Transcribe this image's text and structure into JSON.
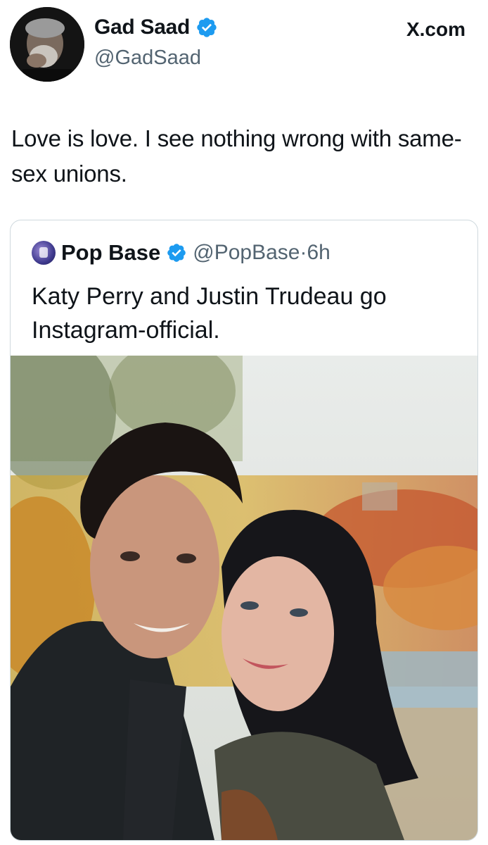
{
  "author": {
    "name": "Gad Saad",
    "handle": "@GadSaad"
  },
  "site_label": "X.com",
  "tweet": {
    "text": "Love is love.  I see nothing wrong with same-sex unions."
  },
  "quoted_tweet": {
    "name": "Pop Base",
    "handle": "@PopBase",
    "separator": "·",
    "time": "6h",
    "text": "Katy Perry and Justin Trudeau go Instagram-official."
  },
  "colors": {
    "verified": "#1d9bf0",
    "text_primary": "#0f1419",
    "text_secondary": "#536471",
    "border": "#cfd9de"
  },
  "icons": {
    "verified": "verified-badge-icon"
  }
}
